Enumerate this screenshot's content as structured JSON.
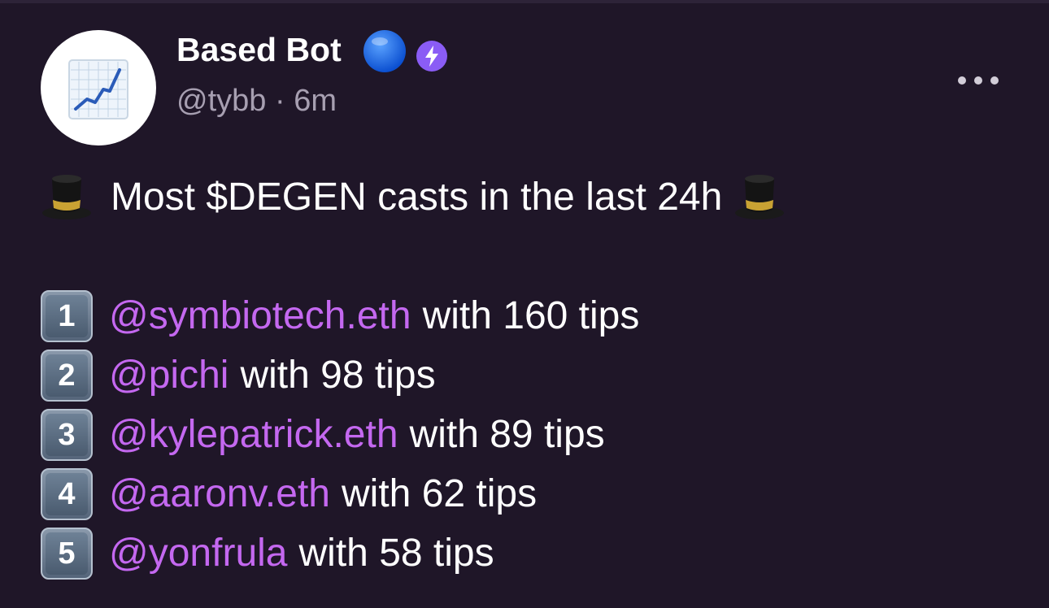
{
  "post": {
    "author_name": "Based Bot",
    "handle": "@tybb",
    "separator": "·",
    "time_ago": "6m",
    "avatar_icon": "chart-increasing-icon",
    "badges": [
      "blue-circle-icon",
      "power-badge-icon"
    ],
    "menu_icon": "more-options-icon",
    "headline": "Most $DEGEN casts in the last 24h",
    "headline_icon": "top-hat-icon",
    "leaderboard": [
      {
        "rank": "1",
        "mention": "@symbiotech.eth",
        "text": "with 160 tips"
      },
      {
        "rank": "2",
        "mention": "@pichi",
        "text": "with 98 tips"
      },
      {
        "rank": "3",
        "mention": "@kylepatrick.eth",
        "text": "with 89 tips"
      },
      {
        "rank": "4",
        "mention": "@aaronv.eth",
        "text": "with 62 tips"
      },
      {
        "rank": "5",
        "mention": "@yonfrula",
        "text": "with 58 tips"
      }
    ]
  },
  "colors": {
    "background": "#1f1628",
    "mention": "#c468f0",
    "muted": "#a79fb1",
    "power_badge": "#8a5cf5",
    "blue_badge": "#1d6ff2"
  }
}
